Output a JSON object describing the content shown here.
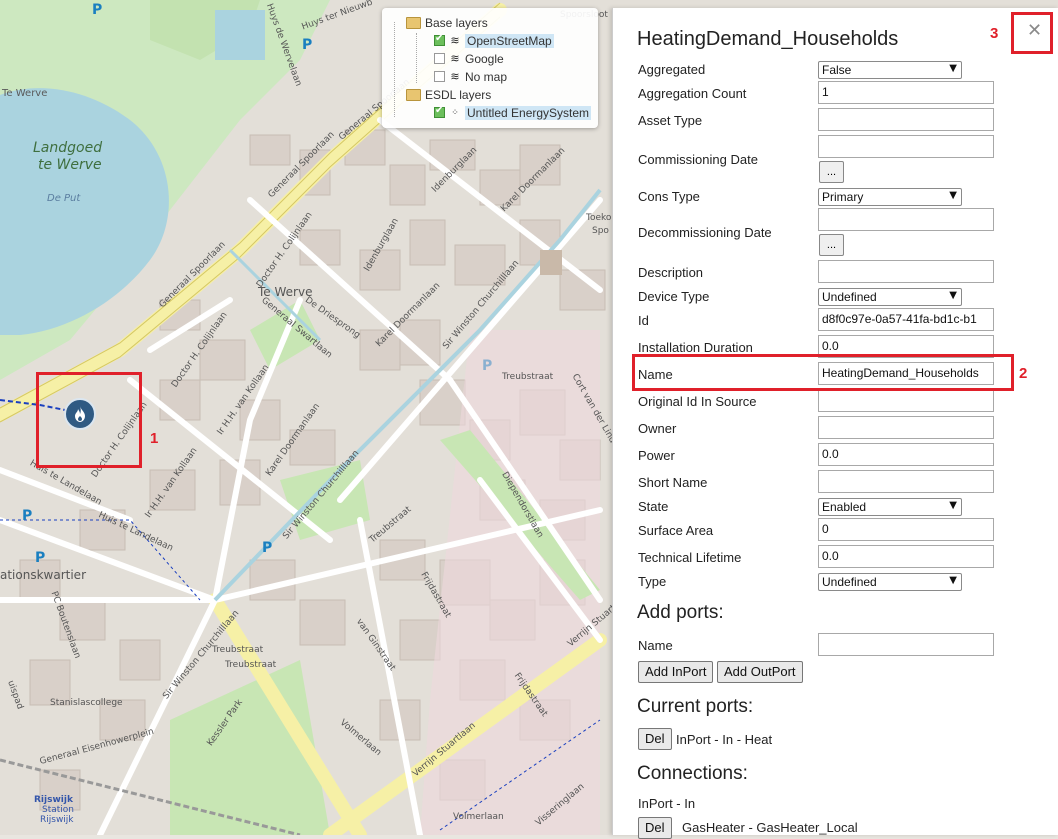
{
  "map": {
    "labels": {
      "te_werve": "Te Werve",
      "landgoed": "Landgoed",
      "te_werve2": "te Werve",
      "de_put": "De Put",
      "te_werve_district": "Te Werve",
      "stationskwartier": "ationskwartier",
      "generaal_spoorlaan": "Generaal Spoorlaan",
      "generaal_spoorlaan2": "Generaal Spoorlaan",
      "doctor_colijnlaan": "Doctor H. Colijnlaan",
      "doctor_colijnlaan2": "Doctor H. Colijnlaan",
      "doctor_colijnlaan3": "Doctor H. Colijnlaan",
      "idenburglaan": "Idenburglaan",
      "idenburglaan2": "Idenburglaan",
      "karel_doormanlaan": "Karel Doormanlaan",
      "karel_doormanlaan2": "Karel Doormanlaan",
      "karel_doormanlaan3": "Karel Doormanlaan",
      "generaal_swartlaan": "Generaal Swartlaan",
      "de_driesprong": "De Driesprong",
      "sir_winston": "Sir Winston Churchilllaan",
      "sir_winston2": "Sir Winston Churchilllaan",
      "sir_winston3": "Sir Winston Churchilllaan",
      "hh_van_kollaan": "Ir H.H. van Kollaan",
      "hh_van_kollaan2": "Ir H.H. van Kollaan",
      "huis_te_landelaan": "Huis te Landelaan",
      "huis_te_landelaan2": "Huis te Landelaan",
      "treubstraat": "Treubstraat",
      "treubstraat2": "Treubstraat",
      "treubstraat3": "Treubstraat",
      "treubstraat4": "Treubstraat",
      "frijdastraat": "Frijdastraat",
      "frijdastraat2": "Frijdastraat",
      "diependorstlaan": "Diependorstlaan",
      "cort_van_der": "Cort van der Lindenstraat",
      "van_ginstraat": "van Ginstraat",
      "verrijn_stuartlaan": "Verrijn Stuartlaan",
      "verrijn_stuartlaan2": "Verrijn Stuartlaan",
      "volmerlaan": "Volmerlaan",
      "volmerlaan2": "Volmerlaan",
      "kessler_park": "Kessler Park",
      "stanislascollege": "Stanislascollege",
      "pc_boutenslaan": "PC Boutenslaan",
      "generaal_eisenhowerplein": "Generaal Eisenhowerplein",
      "rijswijk": "Rijswijk",
      "rijswijk_station": "Station",
      "rijswijk2": "Rijswijk",
      "sporpsoof": "Spoorsloot",
      "huys_de_werve": "Huys de Wervelaan",
      "huys_ter_nieuwburgh": "Huys ter Nieuwb",
      "generaal_spoorlaan3": "Generaal Spoorlaan",
      "visseringlaan": "Visseringlaan",
      "toekomst": "Toekor",
      "toekomst2": "Spo",
      "ruspad": "uispad"
    },
    "parking_symbol": "P"
  },
  "layers": {
    "base_title": "Base layers",
    "options": [
      {
        "label": "OpenStreetMap",
        "checked": true,
        "selected": true
      },
      {
        "label": "Google",
        "checked": false,
        "selected": false
      },
      {
        "label": "No map",
        "checked": false,
        "selected": false
      }
    ],
    "esdl_title": "ESDL layers",
    "esdl_item": {
      "label": "Untitled EnergySystem",
      "checked": true
    }
  },
  "annotations": {
    "box1": "1",
    "box2": "2",
    "box3": "3"
  },
  "panel": {
    "title": "HeatingDemand_Households",
    "close_symbol": "✕",
    "fields": {
      "aggregated": {
        "label": "Aggregated",
        "value": "False"
      },
      "aggregation_count": {
        "label": "Aggregation Count",
        "value": "1"
      },
      "asset_type": {
        "label": "Asset Type",
        "value": ""
      },
      "commissioning_date": {
        "label": "Commissioning Date",
        "value": "",
        "button": "..."
      },
      "cons_type": {
        "label": "Cons Type",
        "value": "Primary"
      },
      "decommissioning_date": {
        "label": "Decommissioning Date",
        "value": "",
        "button": "..."
      },
      "description": {
        "label": "Description",
        "value": ""
      },
      "device_type": {
        "label": "Device Type",
        "value": "Undefined"
      },
      "id": {
        "label": "Id",
        "value": "d8f0c97e-0a57-41fa-bd1c-b1"
      },
      "installation_duration": {
        "label": "Installation Duration",
        "value": "0.0"
      },
      "name": {
        "label": "Name",
        "value": "HeatingDemand_Households"
      },
      "original_id": {
        "label": "Original Id In Source",
        "value": ""
      },
      "owner": {
        "label": "Owner",
        "value": ""
      },
      "power": {
        "label": "Power",
        "value": "0.0"
      },
      "short_name": {
        "label": "Short Name",
        "value": ""
      },
      "state": {
        "label": "State",
        "value": "Enabled"
      },
      "surface_area": {
        "label": "Surface Area",
        "value": "0"
      },
      "technical_lifetime": {
        "label": "Technical Lifetime",
        "value": "0.0"
      },
      "type": {
        "label": "Type",
        "value": "Undefined"
      }
    },
    "add_ports": {
      "heading": "Add ports:",
      "name_label": "Name",
      "name_value": "",
      "add_inport": "Add InPort",
      "add_outport": "Add OutPort"
    },
    "current_ports": {
      "heading": "Current ports:",
      "del_label": "Del",
      "port_text": "InPort - In - Heat"
    },
    "connections": {
      "heading": "Connections:",
      "port_label": "InPort - In",
      "del_label": "Del",
      "connection_text": "GasHeater - GasHeater_Local"
    }
  },
  "colors": {
    "accent_red": "#e0202a",
    "marker_blue": "#2f5a83",
    "water": "#aad3df",
    "park": "#c8e6b4"
  }
}
